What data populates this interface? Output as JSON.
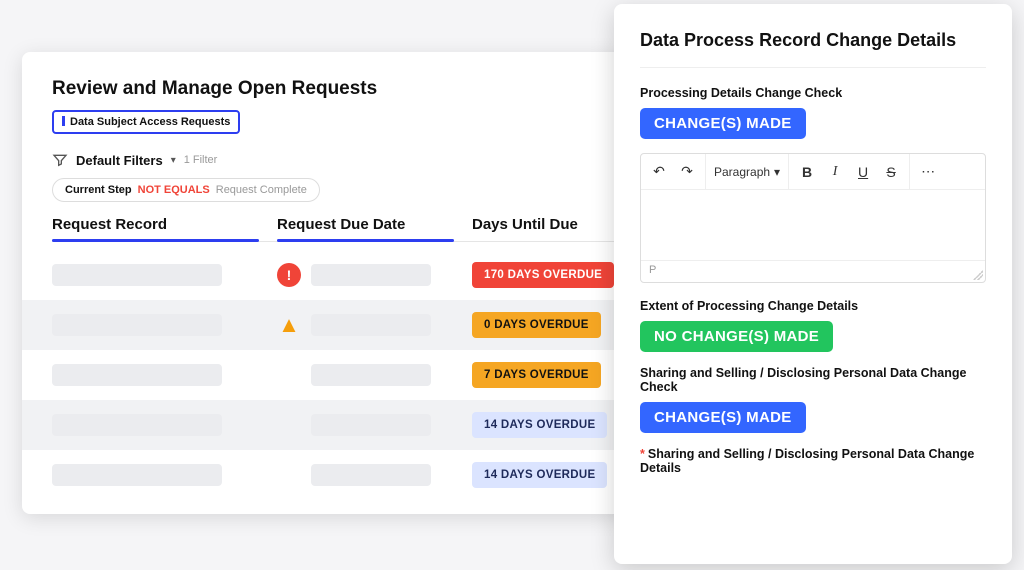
{
  "left": {
    "title": "Review and Manage Open Requests",
    "tag": "Data Subject Access Requests",
    "filters_label": "Default Filters",
    "filters_count": "1 Filter",
    "chip": {
      "step": "Current Step",
      "op": "NOT EQUALS",
      "val": "Request Complete"
    },
    "columns": [
      "Request Record",
      "Request Due Date",
      "Days Until Due"
    ],
    "rows": [
      {
        "icon": "alert-circle",
        "badge": "170 DAYS OVERDUE",
        "variant": "red",
        "alt": false
      },
      {
        "icon": "alert-triangle",
        "badge": "0 DAYS OVERDUE",
        "variant": "amber",
        "alt": true
      },
      {
        "icon": "",
        "badge": "7 DAYS OVERDUE",
        "variant": "amber",
        "alt": false
      },
      {
        "icon": "",
        "badge": "14 DAYS OVERDUE",
        "variant": "blue",
        "alt": true
      },
      {
        "icon": "",
        "badge": "14 DAYS OVERDUE",
        "variant": "blue",
        "alt": false
      }
    ]
  },
  "right": {
    "title": "Data Process Record Change Details",
    "sections": [
      {
        "label": "Processing Details Change Check",
        "pill": "CHANGE(S) MADE",
        "pill_variant": "blue"
      },
      {
        "label": "Extent of Processing Change Details",
        "pill": "NO CHANGE(S) MADE",
        "pill_variant": "green"
      },
      {
        "label": "Sharing and Selling / Disclosing Personal Data Change Check",
        "pill": "CHANGE(S) MADE",
        "pill_variant": "blue"
      },
      {
        "label": "Sharing and Selling / Disclosing Personal Data Change Details",
        "required": true
      }
    ],
    "editor": {
      "style": "Paragraph",
      "path": "P"
    }
  }
}
